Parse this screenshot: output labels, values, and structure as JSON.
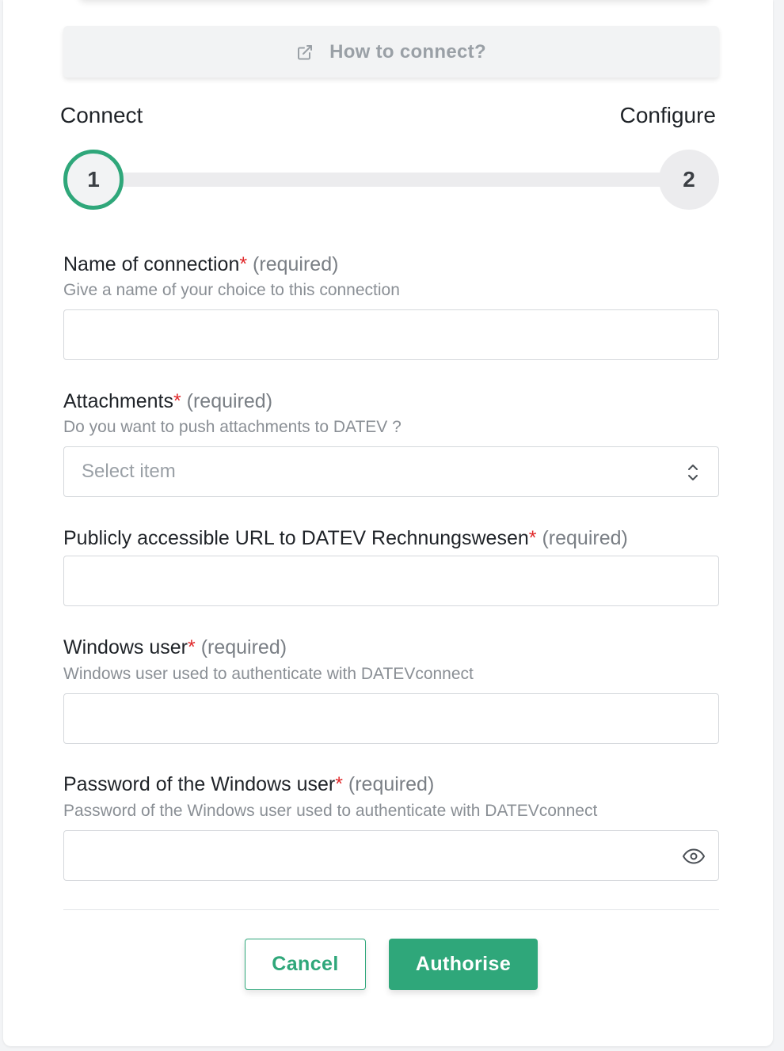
{
  "how_to_connect": {
    "label": "How to connect?",
    "icon": "external-link-icon"
  },
  "stepper": {
    "steps": [
      {
        "title": "Connect",
        "number": "1",
        "state": "active"
      },
      {
        "title": "Configure",
        "number": "2",
        "state": "inactive"
      }
    ],
    "accent_color": "#2fa77a"
  },
  "form": {
    "fields": [
      {
        "label": "Name of connection",
        "required_marker": "*",
        "required_text": "(required)",
        "hint": "Give a name of your choice to this connection",
        "value": "",
        "type": "text"
      },
      {
        "label": "Attachments",
        "required_marker": "*",
        "required_text": "(required)",
        "hint": "Do you want to push attachments to DATEV ?",
        "placeholder": "Select item",
        "type": "select"
      },
      {
        "label": "Publicly accessible URL to DATEV Rechnungswesen",
        "required_marker": "*",
        "required_text": "(required)",
        "value": "",
        "type": "text"
      },
      {
        "label": "Windows user",
        "required_marker": "*",
        "required_text": "(required)",
        "hint": "Windows user used to authenticate with DATEVconnect",
        "value": "",
        "type": "text"
      },
      {
        "label": "Password of the Windows user",
        "required_marker": "*",
        "required_text": "(required)",
        "hint": "Password of the Windows user used to authenticate with DATEVconnect",
        "value": "",
        "type": "password",
        "icon": "eye-icon"
      }
    ]
  },
  "actions": {
    "cancel_label": "Cancel",
    "authorise_label": "Authorise"
  },
  "colors": {
    "primary": "#2fa77a",
    "required_star": "#e0292b"
  }
}
